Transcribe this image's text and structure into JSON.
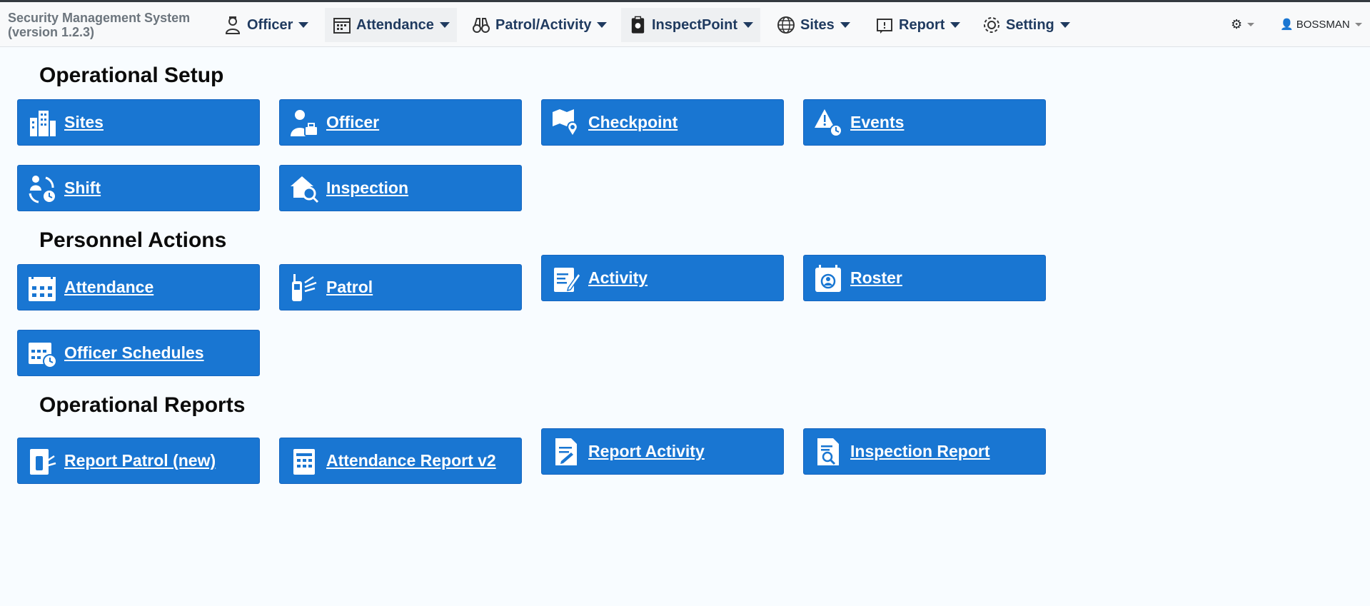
{
  "brand": {
    "line1": "Security Management System",
    "line2": "(version 1.2.3)"
  },
  "nav": {
    "items": [
      {
        "label": "Officer",
        "icon": "officer-icon"
      },
      {
        "label": "Attendance",
        "icon": "calendar-icon"
      },
      {
        "label": "Patrol/Activity",
        "icon": "binoculars-icon"
      },
      {
        "label": "InspectPoint",
        "icon": "clipboard-icon"
      },
      {
        "label": "Sites",
        "icon": "globe-icon"
      },
      {
        "label": "Report",
        "icon": "report-icon"
      },
      {
        "label": "Setting",
        "icon": "gear-icon"
      }
    ],
    "user": "BOSSMAN",
    "settings_icon": "cog-icon"
  },
  "sections": {
    "operational_setup": "Operational Setup",
    "personnel_actions": "Personnel Actions",
    "operational_reports": "Operational Reports"
  },
  "tiles": {
    "sites": "Sites",
    "officer": "Officer",
    "checkpoint": "Checkpoint",
    "events": "Events",
    "shift": "Shift",
    "inspection": "Inspection",
    "attendance": "Attendance",
    "patrol": "Patrol",
    "activity": "Activity",
    "roster": "Roster",
    "officer_schedules": "Officer Schedules",
    "report_patrol": "Report Patrol (new)",
    "attendance_report": "Attendance Report v2",
    "report_activity": "Report Activity",
    "inspection_report": "Inspection Report"
  },
  "colors": {
    "tile": "#1976d2",
    "nav_text": "#1f3a5f",
    "page_bg": "#f8fcff"
  }
}
